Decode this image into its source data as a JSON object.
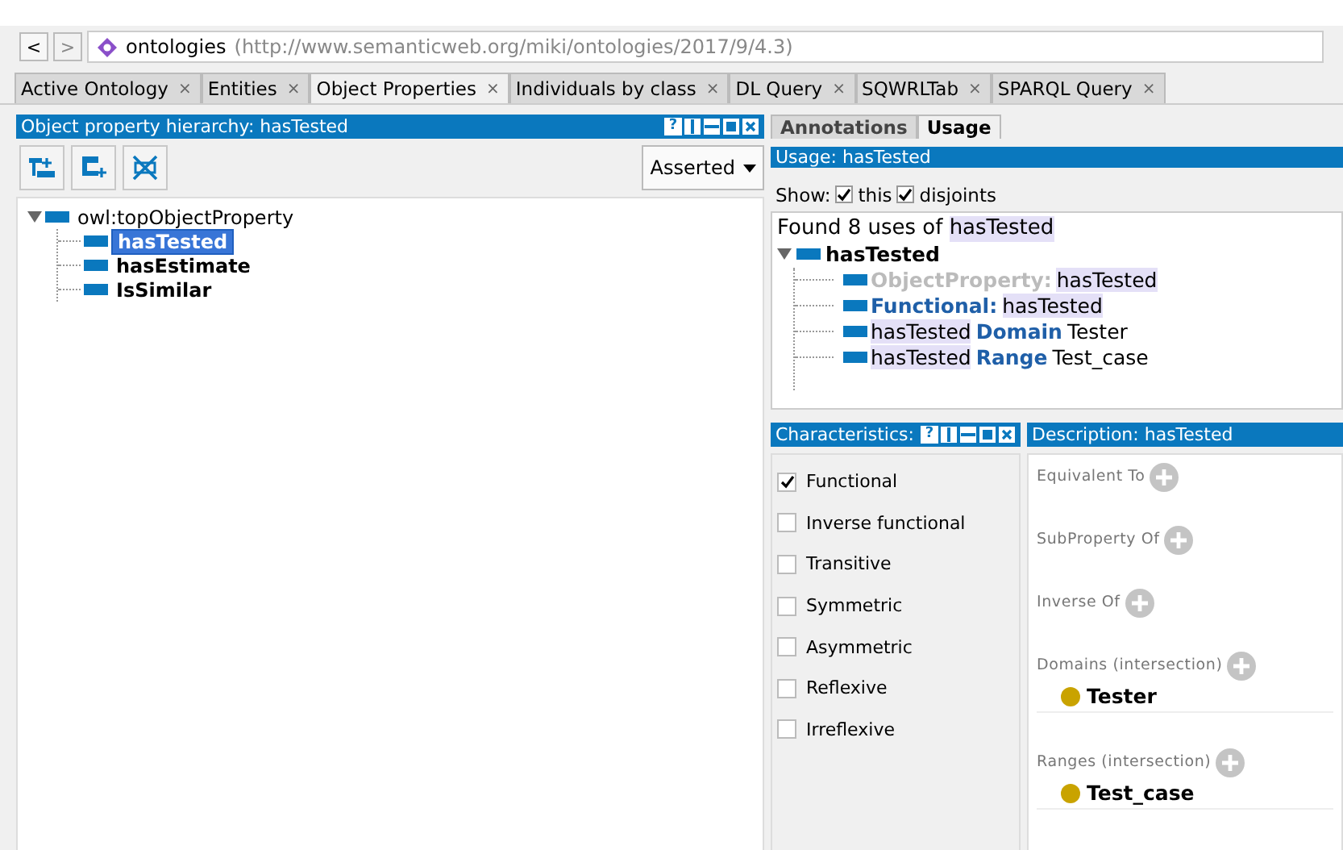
{
  "nav": {
    "back": "<",
    "forward": ">",
    "forward_disabled": true,
    "site": "ontologies",
    "url": "(http://www.semanticweb.org/miki/ontologies/2017/9/4.3)"
  },
  "tabs": [
    {
      "label": "Active Ontology",
      "close": "×",
      "selected": false
    },
    {
      "label": "Entities",
      "close": "×",
      "selected": false
    },
    {
      "label": "Object Properties",
      "close": "×",
      "selected": true
    },
    {
      "label": "Individuals by class",
      "close": "×",
      "selected": false
    },
    {
      "label": "DL Query",
      "close": "×",
      "selected": false
    },
    {
      "label": "SQWRLTab",
      "close": "×",
      "selected": false
    },
    {
      "label": "SPARQL Query",
      "close": "×",
      "selected": false
    }
  ],
  "hierarchy": {
    "title": "Object property hierarchy: hasTested",
    "help": "?",
    "mode": "Asserted",
    "tree": [
      {
        "label": "owl:topObjectProperty",
        "bold": false,
        "selected": false,
        "expanded": true,
        "children": [
          {
            "label": "hasTested",
            "bold": true,
            "selected": true
          },
          {
            "label": "hasEstimate",
            "bold": true,
            "selected": false
          },
          {
            "label": "IsSimilar",
            "bold": true,
            "selected": false
          }
        ]
      }
    ]
  },
  "view_tabs": [
    {
      "label": "Annotations",
      "selected": false
    },
    {
      "label": "Usage",
      "selected": true
    }
  ],
  "usage": {
    "title": "Usage: hasTested",
    "show_label": "Show:",
    "options": [
      {
        "label": "this",
        "checked": true
      },
      {
        "label": "disjoints",
        "checked": true
      }
    ],
    "found": [
      {
        "text": "Found 8 uses of ",
        "kind": "plain"
      },
      {
        "text": "hasTested",
        "kind": "entity"
      }
    ],
    "root": "hasTested",
    "items": [
      [
        {
          "text": "ObjectProperty:",
          "kind": "muted"
        },
        {
          "text": "hasTested",
          "kind": "entity"
        }
      ],
      [
        {
          "text": "Functional:",
          "kind": "keyword"
        },
        {
          "text": "hasTested",
          "kind": "entity"
        }
      ],
      [
        {
          "text": "hasTested",
          "kind": "entity"
        },
        {
          "text": "Domain",
          "kind": "keyword"
        },
        {
          "text": "Tester",
          "kind": "plain"
        }
      ],
      [
        {
          "text": "hasTested",
          "kind": "entity"
        },
        {
          "text": "Range",
          "kind": "keyword"
        },
        {
          "text": "Test_case",
          "kind": "plain"
        }
      ]
    ]
  },
  "characteristics": {
    "title": "Characteristics:",
    "help": "?",
    "items": [
      {
        "label": "Functional",
        "checked": true
      },
      {
        "label": "Inverse functional",
        "checked": false
      },
      {
        "label": "Transitive",
        "checked": false
      },
      {
        "label": "Symmetric",
        "checked": false
      },
      {
        "label": "Asymmetric",
        "checked": false
      },
      {
        "label": "Reflexive",
        "checked": false
      },
      {
        "label": "Irreflexive",
        "checked": false
      }
    ]
  },
  "description": {
    "title": "Description: hasTested",
    "sections": [
      {
        "label": "Equivalent To"
      },
      {
        "label": "SubProperty Of"
      },
      {
        "label": "Inverse Of"
      },
      {
        "label": "Domains (intersection)",
        "entries": [
          {
            "label": "Tester",
            "color": "#c9a300"
          }
        ]
      },
      {
        "label": "Ranges (intersection)",
        "entries": [
          {
            "label": "Test_case",
            "color": "#c9a300"
          }
        ]
      }
    ]
  }
}
